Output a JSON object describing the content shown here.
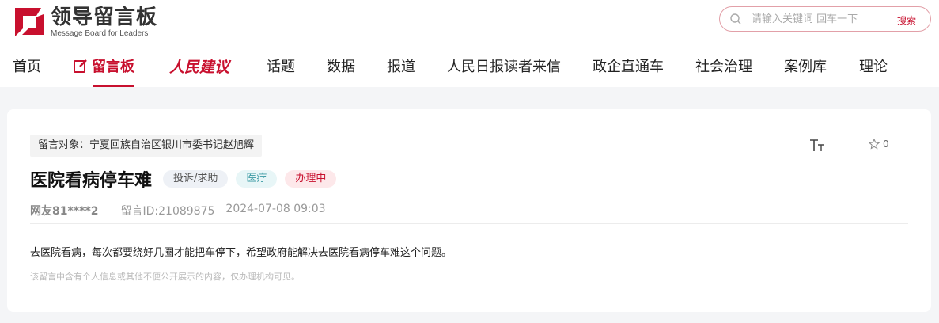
{
  "logo": {
    "title": "领导留言板",
    "subtitle": "Message Board for Leaders"
  },
  "search": {
    "placeholder": "请输入关键词 回车一下",
    "button": "搜索"
  },
  "nav": {
    "items": [
      "首页",
      "留言板",
      "人民建议",
      "话题",
      "数据",
      "报道",
      "人民日报读者来信",
      "政企直通车",
      "社会治理",
      "案例库",
      "理论"
    ],
    "active": "留言板"
  },
  "message": {
    "target": "留言对象：宁夏回族自治区银川市委书记赵旭辉",
    "title": "医院看病停车难",
    "tags": {
      "type": "投诉/求助",
      "field": "医疗",
      "status": "办理中"
    },
    "author": "网友81****2",
    "message_id": "留言ID:21089875",
    "datetime": "2024-07-08 09:03",
    "content": "去医院看病，每次都要绕好几圈才能把车停下，希望政府能解决去医院看病停车难这个问题。",
    "notice": "该留言中含有个人信息或其他不便公开展示的内容，仅办理机构可见。",
    "favorite_count": "0"
  },
  "colors": {
    "brand": "#c8102e",
    "tag_field": "#3a9aa3",
    "background": "#f4f5f7"
  },
  "icons": [
    "logo-mark-icon",
    "search-icon",
    "pen-icon",
    "font-size-icon",
    "star-icon"
  ]
}
